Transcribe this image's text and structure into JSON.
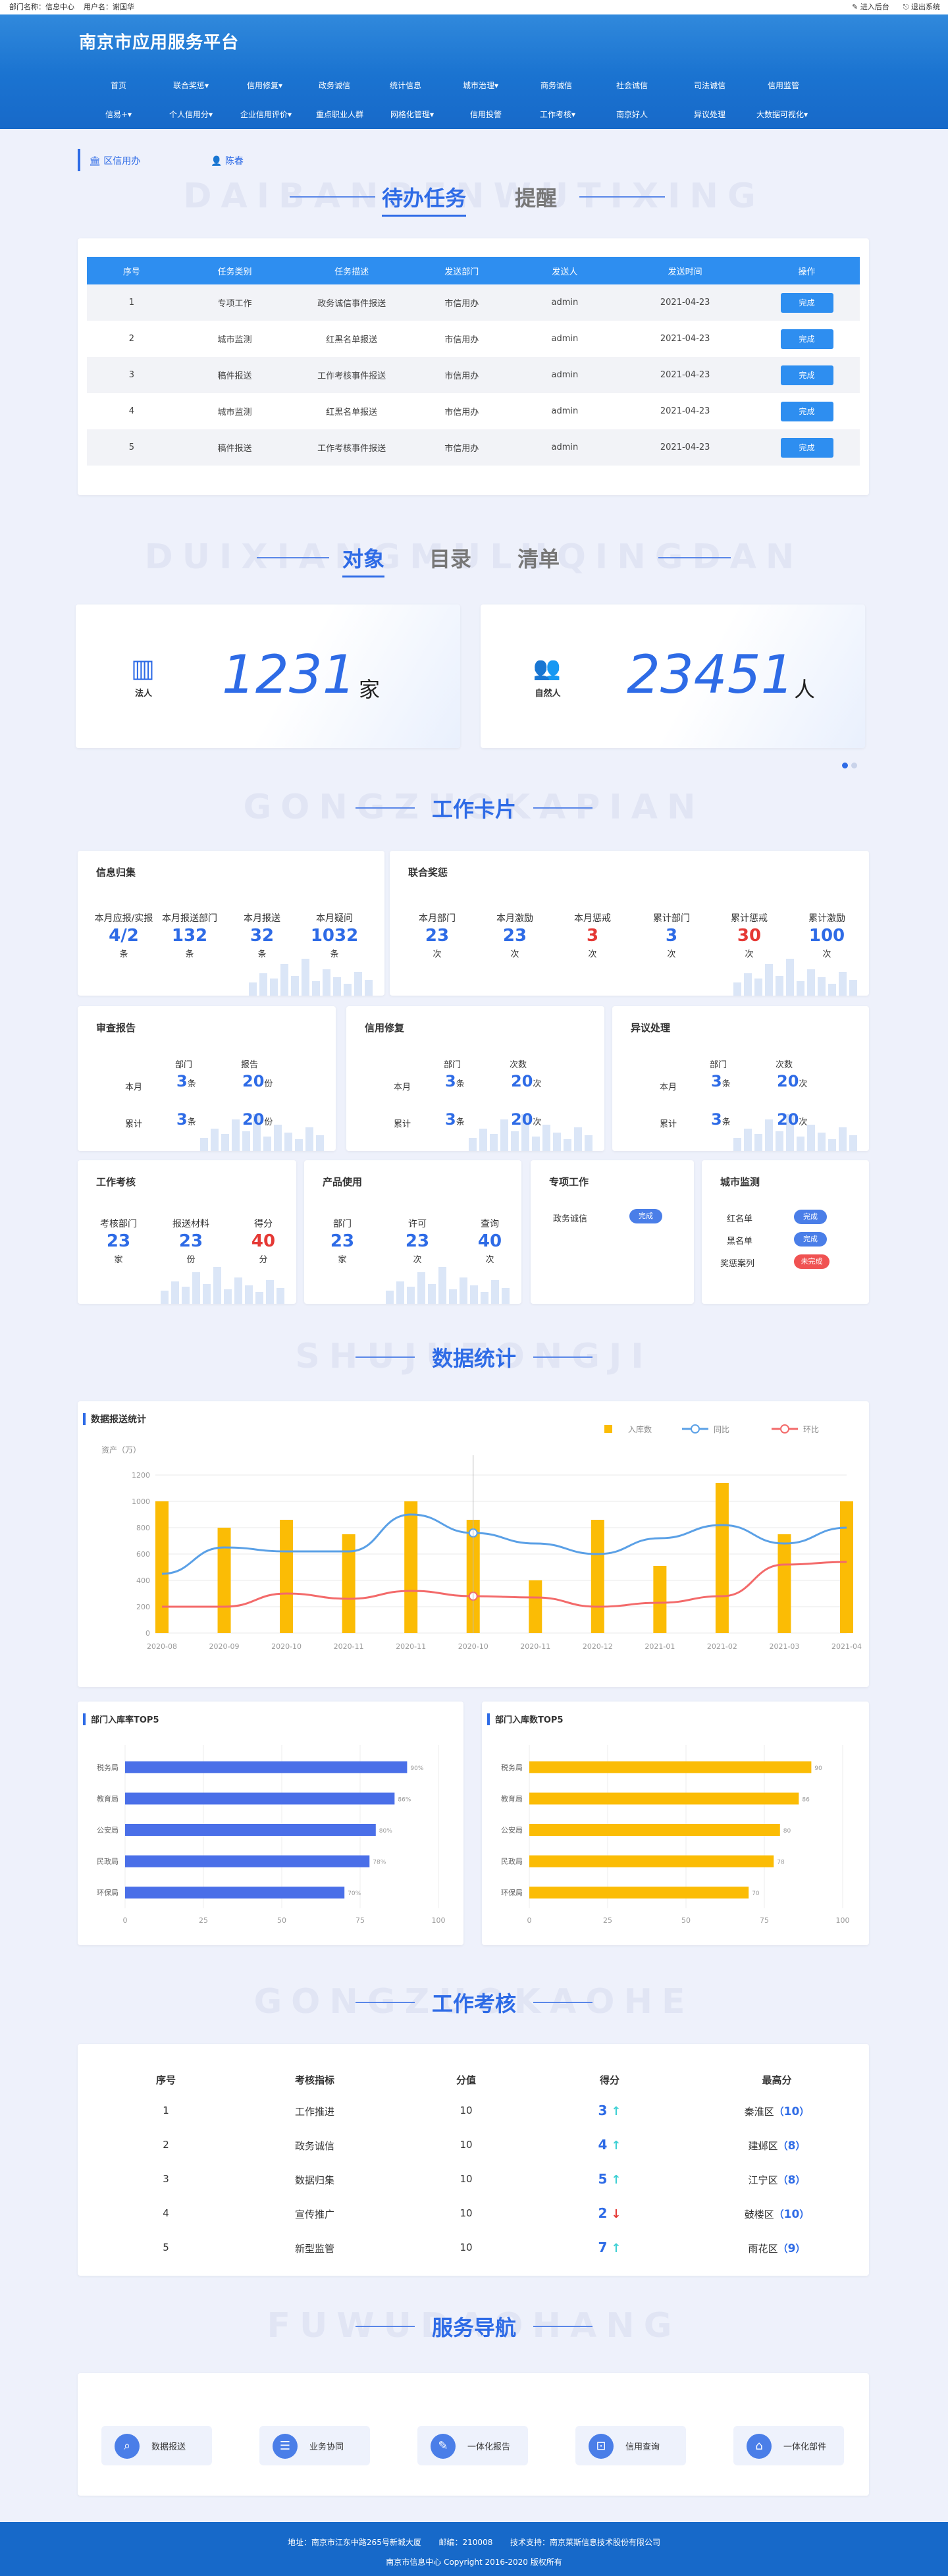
{
  "topbar": {
    "dept": "部门名称：信息中心",
    "user": "用户名：谢国华",
    "enter": "进入后台",
    "logout": "退出系统"
  },
  "header": {
    "title": "南京市应用服务平台"
  },
  "nav1": [
    "首页",
    "联合奖惩▾",
    "信用修复▾",
    "政务诚信",
    "统计信息",
    "城市治理▾",
    "商务诚信",
    "社会诚信",
    "司法诚信",
    "信用监管"
  ],
  "nav2": [
    "信易+▾",
    "个人信用分▾",
    "企业信用评价▾",
    "重点职业人群",
    "网格化管理▾",
    "信用投警",
    "工作考核▾",
    "南京好人",
    "异议处理",
    "大数据可视化▾"
  ],
  "sub": {
    "dept": "区信用办",
    "user": "陈春"
  },
  "tasks": {
    "title": "待办任务",
    "alt": "提醒",
    "bg": "DAIBANRENWUTIXING",
    "columns": [
      "序号",
      "任务类别",
      "任务描述",
      "发送部门",
      "发送人",
      "发送时间",
      "操作"
    ],
    "rows": [
      [
        "1",
        "专项工作",
        "政务诚信事件报送",
        "市信用办",
        "admin",
        "2021-04-23",
        "完成"
      ],
      [
        "2",
        "城市监测",
        "红黑名单报送",
        "市信用办",
        "admin",
        "2021-04-23",
        "完成"
      ],
      [
        "3",
        "稿件报送",
        "工作考核事件报送",
        "市信用办",
        "admin",
        "2021-04-23",
        "完成"
      ],
      [
        "4",
        "城市监测",
        "红黑名单报送",
        "市信用办",
        "admin",
        "2021-04-23",
        "完成"
      ],
      [
        "5",
        "稿件报送",
        "工作考核事件报送",
        "市信用办",
        "admin",
        "2021-04-23",
        "完成"
      ]
    ]
  },
  "objects": {
    "t1": "对象",
    "t2": "目录",
    "t3": "清单",
    "bg": "DUIXIANGMULUQINGDAN",
    "legal": {
      "label": "法人",
      "num": "1231",
      "unit": "家"
    },
    "natural": {
      "label": "自然人",
      "num": "23451",
      "unit": "人"
    }
  },
  "workcards": {
    "title": "工作卡片",
    "bg": "GONGZUOKAPIAN",
    "info": {
      "title": "信息归集",
      "items": [
        [
          "本月应报/实报",
          "4/2",
          "条"
        ],
        [
          "本月报送部门",
          "132",
          "条"
        ],
        [
          "本月报送",
          "32",
          "条"
        ],
        [
          "本月疑问",
          "1032",
          "条"
        ]
      ]
    },
    "joint": {
      "title": "联合奖惩",
      "items": [
        [
          "本月部门",
          "23",
          "次"
        ],
        [
          "本月激励",
          "23",
          "次"
        ],
        [
          "本月惩戒",
          "3",
          "次"
        ],
        [
          "累计部门",
          "3",
          "次"
        ],
        [
          "累计惩戒",
          "30",
          "次"
        ],
        [
          "累计激励",
          "100",
          "次"
        ]
      ]
    },
    "review": {
      "title": "审查报告",
      "h1": "部门",
      "h2": "报告",
      "r1": "本月",
      "r2": "累计",
      "a": "3",
      "au": "条",
      "b": "20",
      "bu": "份",
      "c": "3",
      "cu": "条",
      "d": "20",
      "du": "份"
    },
    "repair": {
      "title": "信用修复",
      "h1": "部门",
      "h2": "次数",
      "r1": "本月",
      "r2": "累计",
      "a": "3",
      "au": "条",
      "b": "20",
      "bu": "次",
      "c": "3",
      "cu": "条",
      "d": "20",
      "du": "次"
    },
    "dispute": {
      "title": "异议处理",
      "h1": "部门",
      "h2": "次数",
      "r1": "本月",
      "r2": "累计",
      "a": "3",
      "au": "条",
      "b": "20",
      "bu": "次",
      "c": "3",
      "cu": "条",
      "d": "20",
      "du": "次"
    },
    "assess": {
      "title": "工作考核",
      "items": [
        [
          "考核部门",
          "23",
          "家"
        ],
        [
          "报送材料",
          "23",
          "份"
        ],
        [
          "得分",
          "40",
          "分"
        ]
      ]
    },
    "usage": {
      "title": "产品使用",
      "items": [
        [
          "部门",
          "23",
          "家"
        ],
        [
          "许可",
          "23",
          "次"
        ],
        [
          "查询",
          "40",
          "次"
        ]
      ]
    },
    "special": {
      "title": "专项工作",
      "label": "政务诚信",
      "btn": "完成"
    },
    "monitor": {
      "title": "城市监测",
      "l1": "红名单",
      "b1": "完成",
      "l2": "黑名单",
      "b2": "完成",
      "l3": "奖惩案列",
      "b3": "未完成"
    }
  },
  "datastats": {
    "title": "数据统计",
    "bg": "SHUJUTONGJI"
  },
  "chart_data": [
    {
      "type": "bar",
      "title": "数据报送统计",
      "ylabel": "资产（万）",
      "ylim": [
        0,
        1200
      ],
      "categories": [
        "2020-08",
        "2020-09",
        "2020-10",
        "2020-11",
        "2020-11",
        "2020-10",
        "2020-11",
        "2020-12",
        "2021-01",
        "2021-02",
        "2021-03",
        "2021-04"
      ],
      "series": [
        {
          "name": "入库数",
          "values": [
            1000,
            800,
            860,
            750,
            1000,
            860,
            400,
            860,
            510,
            1140,
            750,
            1000
          ]
        },
        {
          "name": "同比",
          "values": [
            450,
            650,
            620,
            620,
            900,
            760,
            680,
            600,
            720,
            820,
            680,
            800
          ]
        },
        {
          "name": "环比",
          "values": [
            200,
            200,
            300,
            260,
            320,
            280,
            270,
            200,
            230,
            280,
            520,
            540
          ]
        }
      ]
    },
    {
      "type": "bar",
      "title": "部门入库率TOP5",
      "categories": [
        "税务局",
        "教育局",
        "公安局",
        "民政局",
        "环保局"
      ],
      "values": [
        90,
        86,
        80,
        78,
        70
      ],
      "labels": [
        "90%",
        "86%",
        "80%",
        "78%",
        "70%"
      ],
      "xlim": [
        0,
        100
      ]
    },
    {
      "type": "bar",
      "title": "部门入库数TOP5",
      "categories": [
        "税务局",
        "教育局",
        "公安局",
        "民政局",
        "环保局"
      ],
      "values": [
        90,
        86,
        80,
        78,
        70
      ],
      "labels": [
        "90",
        "86",
        "80",
        "78",
        "70"
      ],
      "xlim": [
        0,
        100
      ]
    }
  ],
  "assessment": {
    "title": "工作考核",
    "bg": "GONGZUOKAOHE",
    "columns": [
      "序号",
      "考核指标",
      "分值",
      "得分",
      "最高分"
    ],
    "rows": [
      [
        "1",
        "工作推进",
        "10",
        "3",
        "秦淮区",
        "10"
      ],
      [
        "2",
        "政务诚信",
        "10",
        "4",
        "建邺区",
        "8"
      ],
      [
        "3",
        "数据归集",
        "10",
        "5",
        "江宁区",
        "8"
      ],
      [
        "4",
        "宣传推广",
        "10",
        "2",
        "鼓楼区",
        "10"
      ],
      [
        "5",
        "新型监管",
        "10",
        "7",
        "雨花区",
        "9"
      ]
    ],
    "trend": [
      "up",
      "up",
      "up",
      "down",
      "up"
    ]
  },
  "services": {
    "title": "服务导航",
    "bg": "FUWUDAOHANG",
    "items": [
      "数据报送",
      "业务协同",
      "一体化报告",
      "信用查询",
      "一体化部件"
    ]
  },
  "footer": {
    "line1a": "地址：南京市江东中路265号新城大厦",
    "line1b": "邮编：210008",
    "line1c": "技术支持：南京莱斯信息技术股份有限公司",
    "line2": "南京市信息中心 Copyright 2016-2020 版权所有"
  },
  "colors": {
    "primary": "#2e6be6",
    "bar_yellow": "#fbbc05",
    "bar_blue": "#4a6fe8",
    "line_blue": "#5aa0e6",
    "line_red": "#f36a6a"
  }
}
